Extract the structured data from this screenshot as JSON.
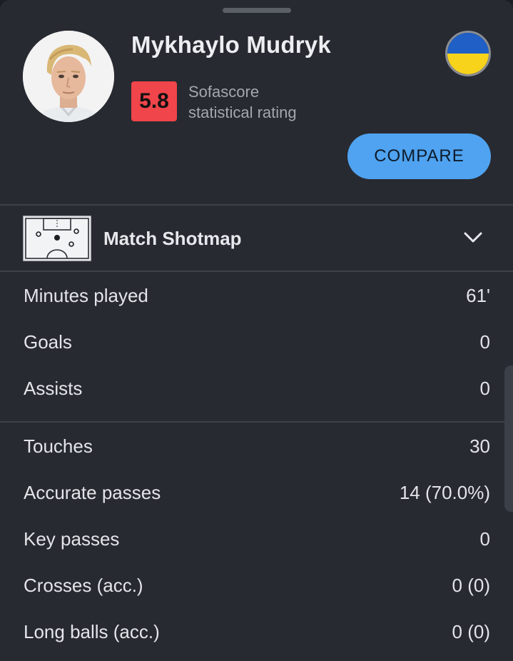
{
  "player": {
    "name": "Mykhaylo Mudryk",
    "rating": "5.8",
    "rating_label_line1": "Sofascore",
    "rating_label_line2": "statistical rating",
    "flag_icon": "ukraine-flag-icon",
    "compare_label": "COMPARE"
  },
  "shotmap": {
    "title": "Match Shotmap",
    "icon": "pitch-shotmap-icon",
    "expand_icon": "chevron-down-icon"
  },
  "stats_group1": [
    {
      "label": "Minutes played",
      "value": "61'"
    },
    {
      "label": "Goals",
      "value": "0"
    },
    {
      "label": "Assists",
      "value": "0"
    }
  ],
  "stats_group2": [
    {
      "label": "Touches",
      "value": "30"
    },
    {
      "label": "Accurate passes",
      "value": "14 (70.0%)"
    },
    {
      "label": "Key passes",
      "value": "0"
    },
    {
      "label": "Crosses (acc.)",
      "value": "0 (0)"
    },
    {
      "label": "Long balls (acc.)",
      "value": "0 (0)"
    }
  ],
  "colors": {
    "background": "#272a31",
    "rating_badge": "#f0454a",
    "compare_button": "#4fa3f0",
    "flag_blue": "#1f5fc6",
    "flag_yellow": "#f7d31c"
  }
}
